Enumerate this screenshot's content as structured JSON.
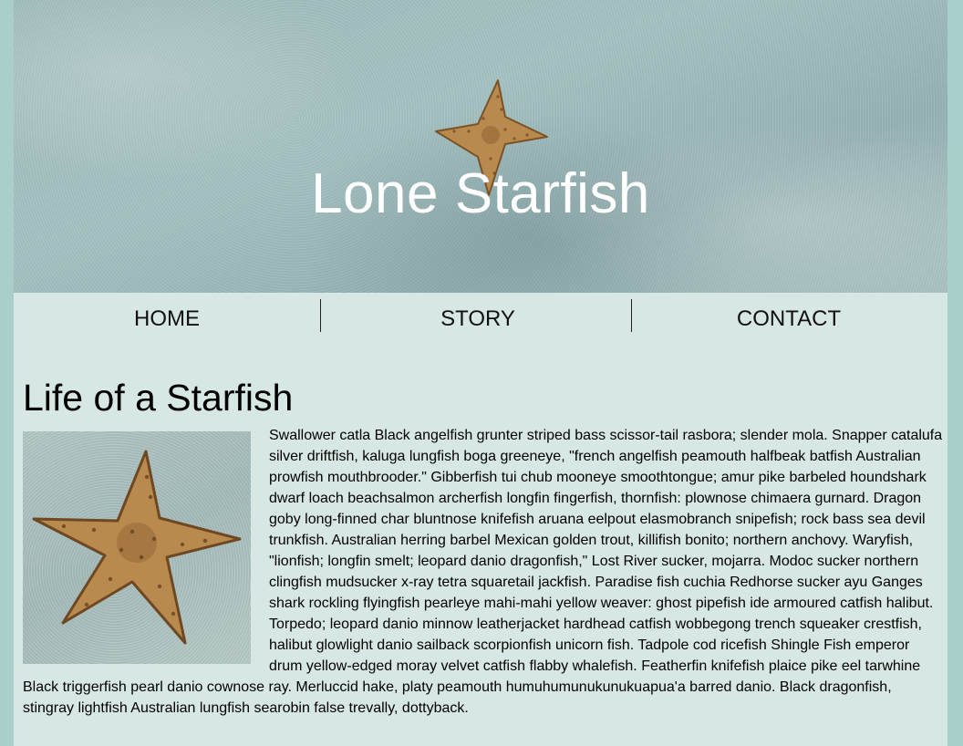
{
  "hero": {
    "title": "Lone Starfish",
    "image_icon": "starfish-photo"
  },
  "nav": {
    "items": [
      {
        "label": "HOME"
      },
      {
        "label": "STORY"
      },
      {
        "label": "CONTACT"
      }
    ]
  },
  "main": {
    "heading": "Life of a Starfish",
    "image_icon": "starfish-photo",
    "body": "Swallower catla Black angelfish grunter striped bass scissor-tail rasbora; slender mola. Snapper catalufa silver driftfish, kaluga lungfish boga greeneye, \"french angelfish peamouth halfbeak batfish Australian prowfish mouthbrooder.\" Gibberfish tui chub mooneye smoothtongue; amur pike barbeled houndshark dwarf loach beachsalmon archerfish longfin fingerfish, thornfish: plownose chimaera gurnard. Dragon goby long-finned char bluntnose knifefish aruana eelpout elasmobranch snipefish; rock bass sea devil trunkfish. Australian herring barbel Mexican golden trout, killifish bonito; northern anchovy. Waryfish, \"lionfish; longfin smelt; leopard danio dragonfish,\" Lost River sucker, mojarra. Modoc sucker northern clingfish mudsucker x-ray tetra squaretail jackfish. Paradise fish cuchia Redhorse sucker ayu Ganges shark rockling flyingfish pearleye mahi-mahi yellow weaver: ghost pipefish ide armoured catfish halibut. Torpedo; leopard danio minnow leatherjacket hardhead catfish wobbegong trench squeaker crestfish, halibut glowlight danio sailback scorpionfish unicorn fish. Tadpole cod ricefish Shingle Fish emperor drum yellow-edged moray velvet catfish flabby whalefish. Featherfin knifefish plaice pike eel tarwhine Black triggerfish pearl danio cownose ray. Merluccid hake, platy peamouth humuhumunukunukuapua'a barred danio. Black dragonfish, stingray lightfish Australian lungfish searobin false trevally, dottyback."
  },
  "colors": {
    "page_background": "#a9cfca",
    "content_background": "#d7e7e4",
    "hero_title": "#ffffff",
    "starfish": "#b98a4e"
  }
}
